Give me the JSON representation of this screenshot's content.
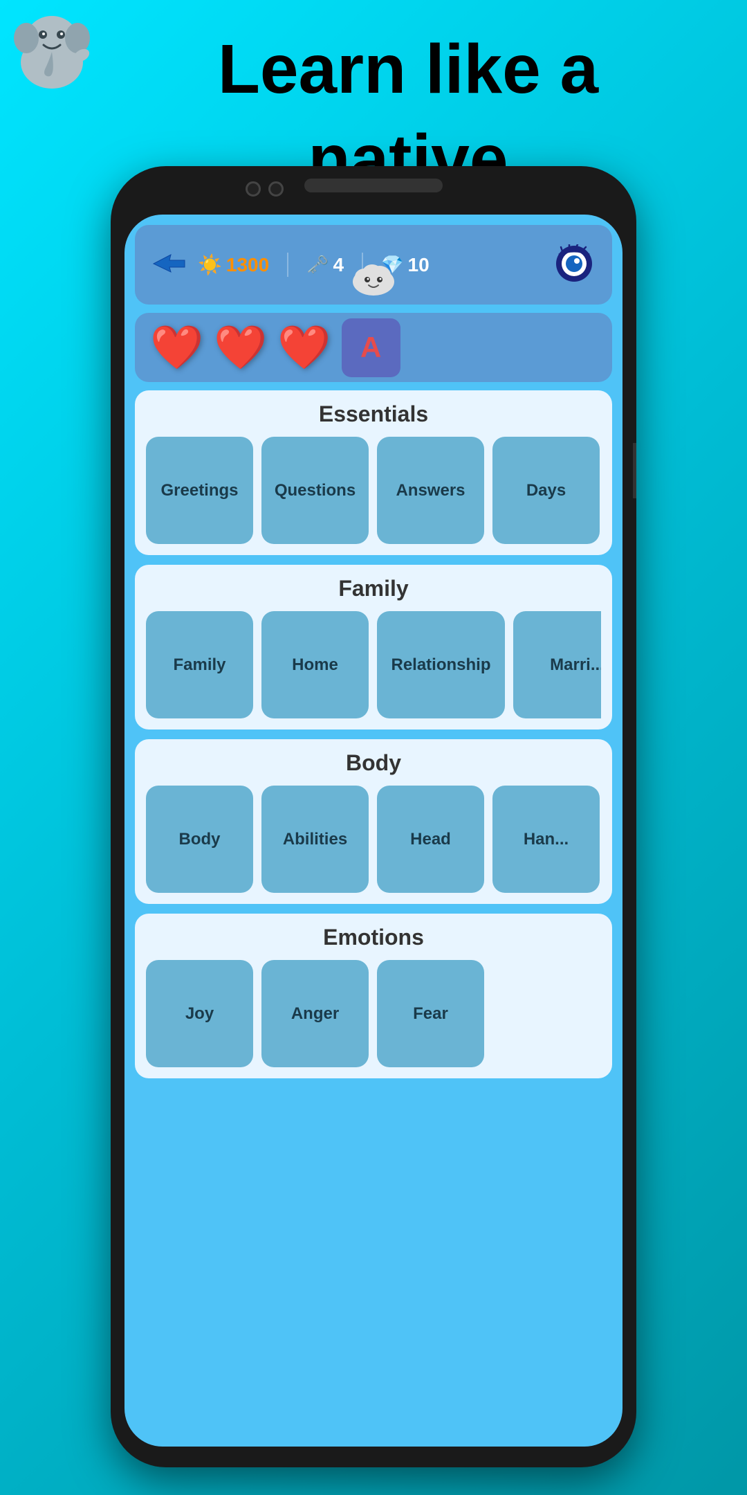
{
  "hero": {
    "title_line1": "Learn like a",
    "title_line2": "native"
  },
  "stats": {
    "xp": "1300",
    "keys": "4",
    "gems": "10"
  },
  "hearts": {
    "count": 3
  },
  "sections": [
    {
      "title": "Essentials",
      "items": [
        "Greetings",
        "Questions",
        "Answers",
        "Days"
      ]
    },
    {
      "title": "Family",
      "items": [
        "Family",
        "Home",
        "Relationship",
        "Marriage"
      ]
    },
    {
      "title": "Body",
      "items": [
        "Body",
        "Abilities",
        "Head",
        "Hands"
      ]
    },
    {
      "title": "Emotions",
      "items": [
        "Joy",
        "Anger",
        "Fear"
      ]
    }
  ],
  "labels": {
    "greetings": "Greetings",
    "questions": "Questions",
    "answers": "Answers",
    "days": "Days",
    "family": "Family",
    "home": "Home",
    "relationship": "Relationship",
    "marriage": "Marri...",
    "body": "Body",
    "abilities": "Abilities",
    "head": "Head",
    "hands": "Han...",
    "emotions": "Emotions"
  }
}
